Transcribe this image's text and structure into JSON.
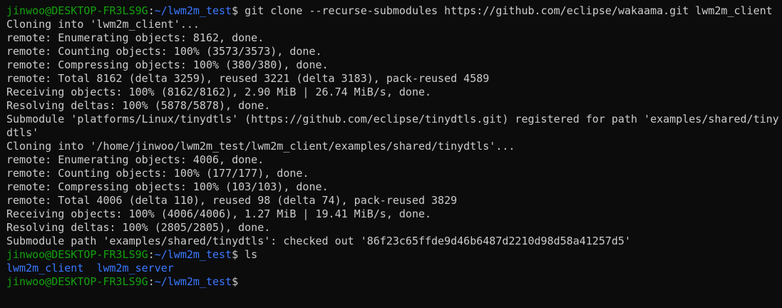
{
  "colors": {
    "background": "#0c0c0c",
    "foreground": "#cccccc",
    "prompt_user": "#13a10e",
    "prompt_path": "#3b78ff",
    "directory": "#3b78ff"
  },
  "prompt": {
    "user_host": "jinwoo@DESKTOP-FR3LS9G",
    "separator": ":",
    "path": "~/lwm2m_test",
    "symbol": "$"
  },
  "commands": {
    "clone": " git clone --recurse-submodules https://github.com/eclipse/wakaama.git lwm2m_client",
    "ls": " ls",
    "empty": ""
  },
  "output_clone": [
    "Cloning into 'lwm2m_client'...",
    "remote: Enumerating objects: 8162, done.",
    "remote: Counting objects: 100% (3573/3573), done.",
    "remote: Compressing objects: 100% (380/380), done.",
    "remote: Total 8162 (delta 3259), reused 3221 (delta 3183), pack-reused 4589",
    "Receiving objects: 100% (8162/8162), 2.90 MiB | 26.74 MiB/s, done.",
    "Resolving deltas: 100% (5878/5878), done.",
    "Submodule 'platforms/Linux/tinydtls' (https://github.com/eclipse/tinydtls.git) registered for path 'examples/shared/tiny",
    "dtls'",
    "Cloning into '/home/jinwoo/lwm2m_test/lwm2m_client/examples/shared/tinydtls'...",
    "remote: Enumerating objects: 4006, done.",
    "remote: Counting objects: 100% (177/177), done.",
    "remote: Compressing objects: 100% (103/103), done.",
    "remote: Total 4006 (delta 110), reused 98 (delta 74), pack-reused 3829",
    "Receiving objects: 100% (4006/4006), 1.27 MiB | 19.41 MiB/s, done.",
    "Resolving deltas: 100% (2805/2805), done.",
    "Submodule path 'examples/shared/tinydtls': checked out '86f23c65ffde9d46b6487d2210d98d58a41257d5'"
  ],
  "output_ls": {
    "entries": [
      "lwm2m_client",
      "lwm2m_server"
    ],
    "gap": "  "
  }
}
